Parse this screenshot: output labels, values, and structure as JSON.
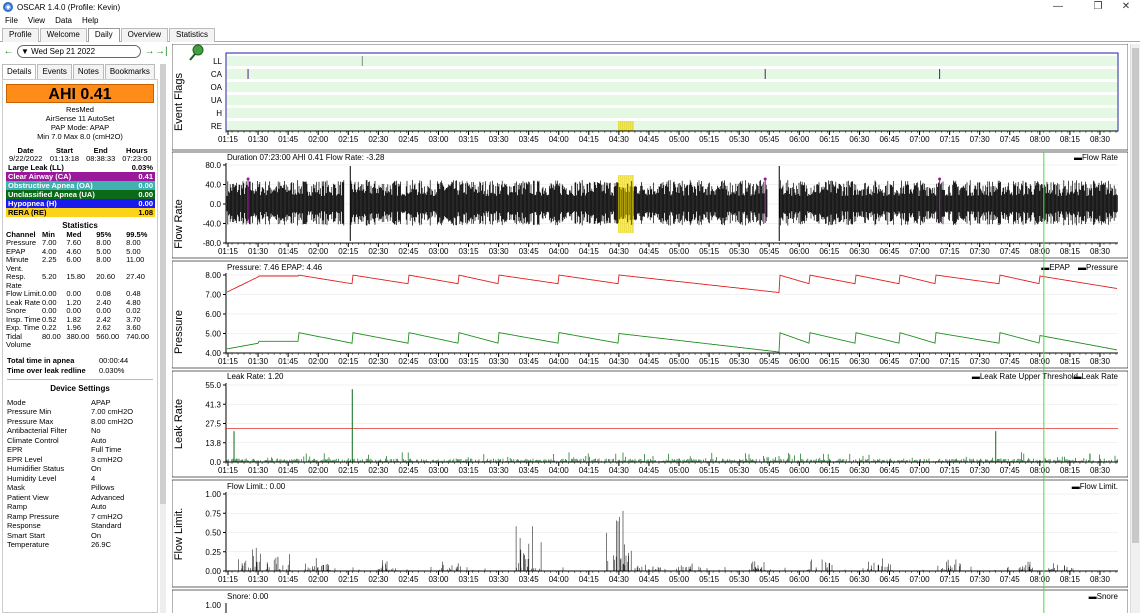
{
  "window": {
    "title": "OSCAR 1.4.0 (Profile: Kevin)",
    "min": "—",
    "max": "❐",
    "close": "✕"
  },
  "menu": [
    "File",
    "View",
    "Data",
    "Help"
  ],
  "tabs": [
    {
      "label": "Profile"
    },
    {
      "label": "Welcome"
    },
    {
      "label": "Daily",
      "active": true
    },
    {
      "label": "Overview"
    },
    {
      "label": "Statistics"
    }
  ],
  "date_nav": {
    "prev": "←",
    "date": "Wed Sep 21 2022",
    "next": "→",
    "last": "→|"
  },
  "left_tabs": [
    {
      "label": "Details",
      "active": true
    },
    {
      "label": "Events"
    },
    {
      "label": "Notes"
    },
    {
      "label": "Bookmarks"
    }
  ],
  "summary": {
    "ahi": "AHI 0.41",
    "brand": "ResMed",
    "model": "AirSense 11 AutoSet",
    "mode": "PAP Mode: APAP",
    "range": "Min 7.0 Max 8.0 (cmH2O)"
  },
  "session": {
    "headers": [
      "Date",
      "Start",
      "End",
      "Hours"
    ],
    "row": [
      "9/22/2022",
      "01:13:18",
      "08:38:33",
      "07:23:00"
    ]
  },
  "events": [
    {
      "label": "Large Leak (LL)",
      "value": "0.03%",
      "bg": "#ffffff",
      "fg": "#000000"
    },
    {
      "label": "Clear Airway (CA)",
      "value": "0.41",
      "bg": "#9a199a",
      "fg": "#ffffff"
    },
    {
      "label": "Obstructive Apnea (OA)",
      "value": "0.00",
      "bg": "#40b0b0",
      "fg": "#ffffff"
    },
    {
      "label": "Unclassified Apnea (UA)",
      "value": "0.00",
      "bg": "#0a6a18",
      "fg": "#ffffff"
    },
    {
      "label": "Hypopnea (H)",
      "value": "0.00",
      "bg": "#1a1aee",
      "fg": "#ffffff"
    },
    {
      "label": "RERA (RE)",
      "value": "1.08",
      "bg": "#ffd21a",
      "fg": "#000000"
    }
  ],
  "stats": {
    "title": "Statistics",
    "headers": [
      "Channel",
      "Min",
      "Med",
      "95%",
      "99.5%"
    ],
    "rows": [
      [
        "Pressure",
        "7.00",
        "7.60",
        "8.00",
        "8.00"
      ],
      [
        "EPAP",
        "4.00",
        "4.60",
        "5.00",
        "5.00"
      ],
      [
        "Minute Vent.",
        "2.25",
        "6.00",
        "8.00",
        "11.00"
      ],
      [
        "Resp. Rate",
        "5.20",
        "15.80",
        "20.60",
        "27.40"
      ],
      [
        "Flow Limit.",
        "0.00",
        "0.00",
        "0.08",
        "0.48"
      ],
      [
        "Leak Rate",
        "0.00",
        "1.20",
        "2.40",
        "4.80"
      ],
      [
        "Snore",
        "0.00",
        "0.00",
        "0.00",
        "0.02"
      ],
      [
        "Insp. Time",
        "0.52",
        "1.82",
        "2.42",
        "3.70"
      ],
      [
        "Exp. Time",
        "0.22",
        "1.96",
        "2.62",
        "3.60"
      ],
      [
        "Tidal Volume",
        "80.00",
        "380.00",
        "560.00",
        "740.00"
      ]
    ]
  },
  "totals": [
    {
      "k": "Total time in apnea",
      "v": "00:00:44"
    },
    {
      "k": "Time over leak redline",
      "v": "0.030%"
    }
  ],
  "device": {
    "title": "Device Settings",
    "rows": [
      {
        "k": "Mode",
        "v": "APAP"
      },
      {
        "k": "Pressure Min",
        "v": "7.00 cmH2O"
      },
      {
        "k": "Pressure Max",
        "v": "8.00 cmH2O"
      },
      {
        "k": "Antibacterial Filter",
        "v": "No"
      },
      {
        "k": "Climate Control",
        "v": "Auto"
      },
      {
        "k": "EPR",
        "v": "Full Time"
      },
      {
        "k": "EPR Level",
        "v": "3 cmH2O"
      },
      {
        "k": "Humidifier Status",
        "v": "On"
      },
      {
        "k": "Humidity Level",
        "v": "4"
      },
      {
        "k": "Mask",
        "v": "Pillows"
      },
      {
        "k": "Patient View",
        "v": "Advanced"
      },
      {
        "k": "Ramp",
        "v": "Auto"
      },
      {
        "k": "Ramp Pressure",
        "v": "7 cmH2O"
      },
      {
        "k": "Response",
        "v": "Standard"
      },
      {
        "k": "Smart Start",
        "v": "On"
      },
      {
        "k": "Temperature",
        "v": "26.9C"
      }
    ]
  },
  "time_ticks": [
    "01:15",
    "01:30",
    "01:45",
    "02:00",
    "02:15",
    "02:30",
    "02:45",
    "03:00",
    "03:15",
    "03:30",
    "03:45",
    "04:00",
    "04:15",
    "04:30",
    "04:45",
    "05:00",
    "05:15",
    "05:30",
    "05:45",
    "06:00",
    "06:15",
    "06:30",
    "06:45",
    "07:00",
    "07:15",
    "07:30",
    "07:45",
    "08:00",
    "08:15",
    "08:30"
  ],
  "colors": {
    "flag_bg": "#e4f8e4",
    "flow": "#000000",
    "pressure": "#e02020",
    "epap": "#209020",
    "leak": "#0a6a18",
    "threshold": "#e03030",
    "cursor": "#40e040",
    "ca": "#9a199a",
    "re": "#e8d000"
  },
  "charts": [
    {
      "id": "event_flags",
      "title": "Event Flags",
      "rows": [
        "LL",
        "CA",
        "OA",
        "UA",
        "H",
        "RE"
      ],
      "events": {
        "CA": [
          "01:25",
          "05:43",
          "07:10"
        ],
        "RE": [
          "04:30",
          "04:31",
          "04:32",
          "04:33",
          "04:34",
          "04:35",
          "04:36",
          "04:37"
        ],
        "LL": [
          "02:22"
        ]
      }
    },
    {
      "id": "flow_rate",
      "title": "Flow Rate",
      "header": "Duration 07:23:00 AHI 0.41 Flow Rate: -3.28",
      "legend": [
        "Flow Rate"
      ],
      "yticks": [
        "80.0",
        "40.0",
        "0.0",
        "-40.0",
        "-80.0"
      ],
      "ylim": [
        -80,
        80
      ]
    },
    {
      "id": "pressure",
      "title": "Pressure",
      "header": "Pressure: 7.46 EPAP: 4.46",
      "legend": [
        "EPAP",
        "Pressure"
      ],
      "yticks": [
        "8.00",
        "7.00",
        "6.00",
        "5.00",
        "4.00"
      ],
      "ylim": [
        4,
        8
      ]
    },
    {
      "id": "leak_rate",
      "title": "Leak Rate",
      "header": "Leak Rate: 1.20",
      "legend": [
        "Leak Rate Upper Threshold",
        "Leak Rate"
      ],
      "yticks": [
        "55.0",
        "41.3",
        "27.5",
        "13.8",
        "0.0"
      ],
      "ylim": [
        0,
        55
      ],
      "threshold": 24
    },
    {
      "id": "flow_limit",
      "title": "Flow Limit.",
      "header": "Flow Limit.: 0.00",
      "legend": [
        "Flow Limit."
      ],
      "yticks": [
        "1.00",
        "0.75",
        "0.50",
        "0.25",
        "0.00"
      ],
      "ylim": [
        0,
        1
      ]
    },
    {
      "id": "snore",
      "header": "Snore: 0.00",
      "legend": [
        "Snore"
      ],
      "yticks": [
        "1.00"
      ]
    }
  ]
}
